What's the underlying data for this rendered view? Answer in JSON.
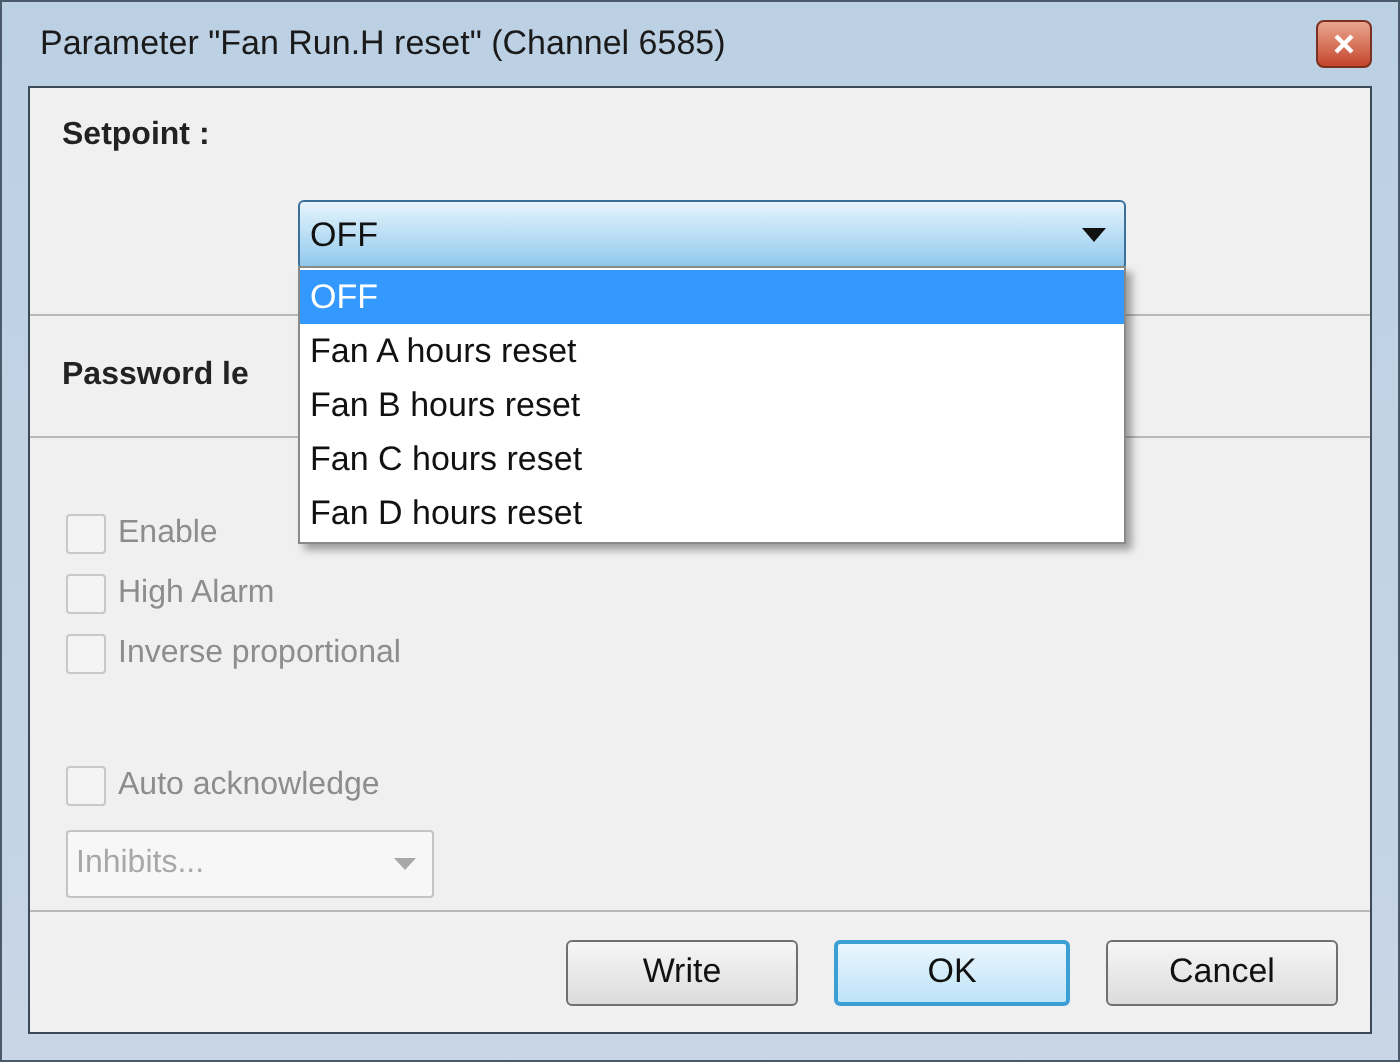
{
  "window": {
    "title": "Parameter \"Fan Run.H reset\" (Channel 6585)"
  },
  "setpoint": {
    "label": "Setpoint :",
    "value": "OFF",
    "expanded": true,
    "options": [
      {
        "label": "OFF",
        "selected": true
      },
      {
        "label": "Fan A hours reset",
        "selected": false
      },
      {
        "label": "Fan B hours reset",
        "selected": false
      },
      {
        "label": "Fan C hours reset",
        "selected": false
      },
      {
        "label": "Fan D hours reset",
        "selected": false
      }
    ]
  },
  "password_section": {
    "label": "Password le"
  },
  "checkboxes": [
    {
      "label": "Enable",
      "checked": false,
      "disabled": true
    },
    {
      "label": "High Alarm",
      "checked": false,
      "disabled": true
    },
    {
      "label": "Inverse proportional",
      "checked": false,
      "disabled": true
    },
    {
      "label": "Auto acknowledge",
      "checked": false,
      "disabled": true
    }
  ],
  "inhibits": {
    "value": "Inhibits...",
    "disabled": true
  },
  "buttons": [
    {
      "label": "Write",
      "default": false
    },
    {
      "label": "OK",
      "default": true
    },
    {
      "label": "Cancel",
      "default": false
    }
  ]
}
